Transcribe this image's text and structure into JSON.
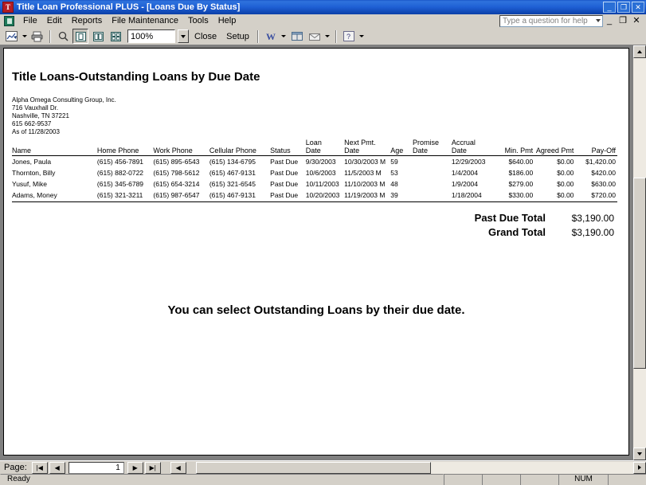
{
  "window": {
    "title": "Title Loan Professional PLUS - [Loans Due By Status]",
    "app_icon": "app-icon",
    "minimize": "_",
    "maximize": "❐",
    "close": "✕"
  },
  "menu": {
    "items": [
      {
        "label": "File"
      },
      {
        "label": "Edit"
      },
      {
        "label": "Reports"
      },
      {
        "label": "File Maintenance"
      },
      {
        "label": "Tools"
      },
      {
        "label": "Help"
      }
    ],
    "help_search_placeholder": "Type a question for help",
    "mdi_minimize": "_",
    "mdi_restore": "❐",
    "mdi_close": "✕"
  },
  "toolbar": {
    "export_icon": "export-chart-icon",
    "print_icon": "print-icon",
    "zoom_icon": "magnifier-icon",
    "view_one_page_icon": "one-page-view-icon",
    "view_two_page_icon": "two-page-view-icon",
    "view_fit_icon": "fit-page-icon",
    "zoom_value": "100%",
    "close_label": "Close",
    "setup_label": "Setup",
    "word_icon": "word-export-icon",
    "email_icon": "email-icon",
    "window_icon": "window-icon",
    "help_icon": "help-icon"
  },
  "report": {
    "title": "Title Loans-Outstanding Loans by Due Date",
    "company": [
      "Alpha Omega Consulting Group, Inc.",
      "716 Vauxhall Dr.",
      "Nashville, TN 37221",
      "615 662-9537",
      "As of  11/28/2003"
    ],
    "columns": [
      "Name",
      "Home Phone",
      "Work Phone",
      "Cellular Phone",
      "Status",
      "Loan Date",
      "Next Pmt. Date",
      "Age",
      "Promise Date",
      "Accrual Date",
      "Min. Pmt",
      "Agreed Pmt",
      "Pay-Off"
    ],
    "column_lines": [
      [
        "Name",
        ""
      ],
      [
        "Home Phone",
        ""
      ],
      [
        "Work Phone",
        ""
      ],
      [
        "Cellular Phone",
        ""
      ],
      [
        "Status",
        ""
      ],
      [
        "Loan",
        "Date"
      ],
      [
        "Next Pmt.",
        "Date"
      ],
      [
        "",
        "Age"
      ],
      [
        "Promise",
        "Date"
      ],
      [
        "Accrual",
        "Date"
      ],
      [
        "",
        "Min. Pmt"
      ],
      [
        "",
        "Agreed Pmt"
      ],
      [
        "",
        "Pay-Off"
      ]
    ],
    "rows": [
      {
        "name": "Jones, Paula",
        "home_phone": "(615) 456-7891",
        "work_phone": "(615) 895-6543",
        "cell_phone": "(615) 134-6795",
        "status": "Past Due",
        "loan_date": "9/30/2003",
        "next_pmt_date": "10/30/2003 M",
        "age": "59",
        "promise_date": "",
        "accrual_date": "12/29/2003",
        "min_pmt": "$640.00",
        "agreed_pmt": "$0.00",
        "pay_off": "$1,420.00"
      },
      {
        "name": "Thornton, Billy",
        "home_phone": "(615) 882-0722",
        "work_phone": "(615) 798-5612",
        "cell_phone": "(615) 467-9131",
        "status": "Past Due",
        "loan_date": "10/6/2003",
        "next_pmt_date": "11/5/2003 M",
        "age": "53",
        "promise_date": "",
        "accrual_date": "1/4/2004",
        "min_pmt": "$186.00",
        "agreed_pmt": "$0.00",
        "pay_off": "$420.00"
      },
      {
        "name": "Yusuf, Mike",
        "home_phone": "(615) 345-6789",
        "work_phone": "(615) 654-3214",
        "cell_phone": "(615) 321-6545",
        "status": "Past Due",
        "loan_date": "10/11/2003",
        "next_pmt_date": "11/10/2003 M",
        "age": "48",
        "promise_date": "",
        "accrual_date": "1/9/2004",
        "min_pmt": "$279.00",
        "agreed_pmt": "$0.00",
        "pay_off": "$630.00"
      },
      {
        "name": "Adams, Money",
        "home_phone": "(615) 321-3211",
        "work_phone": "(615) 987-6547",
        "cell_phone": "(615) 467-9131",
        "status": "Past Due",
        "loan_date": "10/20/2003",
        "next_pmt_date": "11/19/2003 M",
        "age": "39",
        "promise_date": "",
        "accrual_date": "1/18/2004",
        "min_pmt": "$330.00",
        "agreed_pmt": "$0.00",
        "pay_off": "$720.00"
      }
    ],
    "totals": [
      {
        "label": "Past Due  Total",
        "value": "$3,190.00"
      },
      {
        "label": "Grand Total",
        "value": "$3,190.00"
      }
    ],
    "caption": "You can select Outstanding Loans by their due date."
  },
  "pagebar": {
    "label": "Page:",
    "first": "|◀",
    "prev": "◀",
    "page_number": "1",
    "next": "▶",
    "last": "▶|",
    "stop": "◀",
    "hscroll_right": "▶"
  },
  "statusbar": {
    "message": "Ready",
    "cells": [
      "",
      "",
      "",
      "NUM",
      ""
    ]
  },
  "colors": {
    "titlebar_blue": "#1e5fd4",
    "chrome_gray": "#d4d0c8",
    "page_white": "#ffffff",
    "client_gray": "#808080"
  }
}
